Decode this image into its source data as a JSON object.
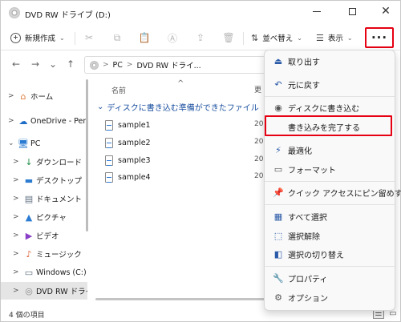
{
  "window": {
    "title": "DVD RW ドライブ (D:)",
    "minimize_glyph": "—",
    "maximize_glyph": "☐",
    "close_glyph": "✕"
  },
  "toolbar": {
    "new_label": "新規作成",
    "new_chevron": "⌄",
    "sort_label": "並べ替え",
    "sort_chevron": "⌄",
    "view_label": "表示",
    "view_chevron": "⌄",
    "more_label": "···",
    "tools": [
      {
        "name": "cut-icon",
        "glyph": "✂"
      },
      {
        "name": "copy-icon",
        "glyph": "⧉"
      },
      {
        "name": "paste-icon",
        "glyph": "📋"
      },
      {
        "name": "rename-icon",
        "glyph": "Ⓐ"
      },
      {
        "name": "share-icon",
        "glyph": "⇪"
      },
      {
        "name": "delete-icon",
        "glyph": "🗑"
      }
    ],
    "more_highlight_color": "#e60012"
  },
  "navigation": {
    "back_glyph": "←",
    "forward_glyph": "→",
    "recent_glyph": "⌄",
    "up_glyph": "↑",
    "breadcrumb": [
      "PC",
      "DVD RW ドライ..."
    ],
    "separator": ">"
  },
  "sidebar": {
    "items": [
      {
        "label": "ホーム",
        "icon": "home-icon",
        "glyph": "⌂",
        "color": "#e07b39",
        "chevron": ">"
      },
      {
        "label": "OneDrive - Perso",
        "icon": "cloud-icon",
        "glyph": "☁",
        "color": "#1e6ec8",
        "chevron": ">"
      },
      {
        "label": "PC",
        "icon": "pc-icon",
        "glyph": "🖥",
        "color": "#2a7bd1",
        "chevron": "⌄"
      },
      {
        "label": "ダウンロード",
        "icon": "download-icon",
        "glyph": "↓",
        "color": "#1f8f4a",
        "chevron": ">"
      },
      {
        "label": "デスクトップ",
        "icon": "desktop-icon",
        "glyph": "▬",
        "color": "#2a7bd1",
        "chevron": ">"
      },
      {
        "label": "ドキュメント",
        "icon": "documents-icon",
        "glyph": "▤",
        "color": "#607080",
        "chevron": ">"
      },
      {
        "label": "ピクチャ",
        "icon": "pictures-icon",
        "glyph": "▲",
        "color": "#2a7bd1",
        "chevron": ">"
      },
      {
        "label": "ビデオ",
        "icon": "videos-icon",
        "glyph": "▶",
        "color": "#8a3fc8",
        "chevron": ">"
      },
      {
        "label": "ミュージック",
        "icon": "music-icon",
        "glyph": "♪",
        "color": "#e0603a",
        "chevron": ">"
      },
      {
        "label": "Windows (C:)",
        "icon": "drive-icon",
        "glyph": "▭",
        "color": "#5a6a7a",
        "chevron": ">"
      },
      {
        "label": "DVD RW ドライブ",
        "icon": "disc-icon",
        "glyph": "◎",
        "color": "#8a8a8a",
        "chevron": ">"
      }
    ]
  },
  "content": {
    "column_name": "名前",
    "column_date_fragment": "更",
    "sort_caret": "^",
    "group_label": "ディスクに書き込む準備ができたファイル",
    "group_chevron": "⌄",
    "files": [
      {
        "name": "sample1",
        "date_fragment": "20"
      },
      {
        "name": "sample2",
        "date_fragment": "20"
      },
      {
        "name": "sample3",
        "date_fragment": "20"
      },
      {
        "name": "sample4",
        "date_fragment": "20"
      }
    ]
  },
  "status": {
    "item_count": "4 個の項目"
  },
  "menu": {
    "items": [
      {
        "label": "取り出す",
        "icon": "eject-icon",
        "glyph": "⏏"
      },
      {
        "label": "元に戻す",
        "icon": "undo-icon",
        "glyph": "↶"
      },
      {
        "label": "ディスクに書き込む",
        "icon": "burn-disc-icon",
        "glyph": "◉"
      },
      {
        "label": "書き込みを完了する",
        "icon": "finish-burn-icon",
        "glyph": ""
      },
      {
        "label": "最適化",
        "icon": "optimize-icon",
        "glyph": "⚡"
      },
      {
        "label": "フォーマット",
        "icon": "format-icon",
        "glyph": "▭"
      },
      {
        "label": "クイック アクセスにピン留めする",
        "icon": "pin-icon",
        "glyph": "📌"
      },
      {
        "label": "すべて選択",
        "icon": "select-all-icon",
        "glyph": "▦"
      },
      {
        "label": "選択解除",
        "icon": "select-none-icon",
        "glyph": "⬚"
      },
      {
        "label": "選択の切り替え",
        "icon": "invert-selection-icon",
        "glyph": "◧"
      },
      {
        "label": "プロパティ",
        "icon": "properties-icon",
        "glyph": "🔧"
      },
      {
        "label": "オプション",
        "icon": "options-icon",
        "glyph": "⚙"
      }
    ],
    "highlighted_item": "書き込みを完了する",
    "highlight_color": "#e60012"
  }
}
